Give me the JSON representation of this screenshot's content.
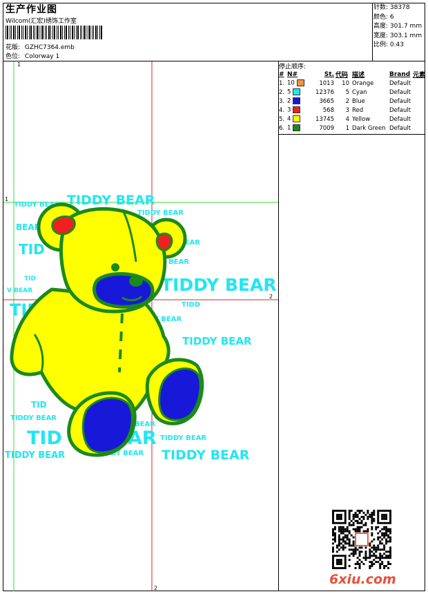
{
  "header": {
    "title": "生产作业图",
    "company": "Wilcom(汇宏)绣饰工作室",
    "design_label": "花版:",
    "design_value": "GZHC7364.emb",
    "colorway_label": "色位:",
    "colorway_value": "Colorway 1"
  },
  "stats": [
    {
      "label": "针数:",
      "value": "38378"
    },
    {
      "label": "颜色:",
      "value": "6"
    },
    {
      "label": "高度:",
      "value": "301.7 mm"
    },
    {
      "label": "宽度:",
      "value": "303.1 mm"
    },
    {
      "label": "比例:",
      "value": "0.43"
    }
  ],
  "stop_sequence": {
    "title": "停止顺序:",
    "headers": [
      "#",
      "N#",
      "St.",
      "代码",
      "描述",
      "Brand",
      "元素"
    ],
    "rows": [
      {
        "idx": "1.",
        "n": "10",
        "color": "#f7923a",
        "st": "1013",
        "code": "10",
        "desc": "Orange",
        "brand": "Default"
      },
      {
        "idx": "2.",
        "n": "5",
        "color": "#22e6f0",
        "st": "12376",
        "code": "5",
        "desc": "Cyan",
        "brand": "Default"
      },
      {
        "idx": "3.",
        "n": "2",
        "color": "#1818d8",
        "st": "3665",
        "code": "2",
        "desc": "Blue",
        "brand": "Default"
      },
      {
        "idx": "4.",
        "n": "3",
        "color": "#f02020",
        "st": "568",
        "code": "3",
        "desc": "Red",
        "brand": "Default"
      },
      {
        "idx": "5.",
        "n": "4",
        "color": "#ffff00",
        "st": "13745",
        "code": "4",
        "desc": "Yellow",
        "brand": "Default"
      },
      {
        "idx": "6.",
        "n": "1",
        "color": "#1b8a1b",
        "st": "7009",
        "code": "1",
        "desc": "Dark Green",
        "brand": "Default"
      }
    ]
  },
  "design": {
    "text": "TIDDY BEAR",
    "fragments": [
      "TID",
      "BEAR",
      "TIDD",
      "AR",
      "V BEAR",
      "DY BEAR"
    ],
    "guide_labels": {
      "v1": "1",
      "h1": "1",
      "h2": "2",
      "v2": "2"
    },
    "colors": {
      "yellow": "#ffff00",
      "green": "#1b8a1b",
      "cyan": "#22e6f0",
      "blue": "#1818d8",
      "red": "#f02020"
    }
  },
  "footer": {
    "logo": "6xiu.com"
  }
}
